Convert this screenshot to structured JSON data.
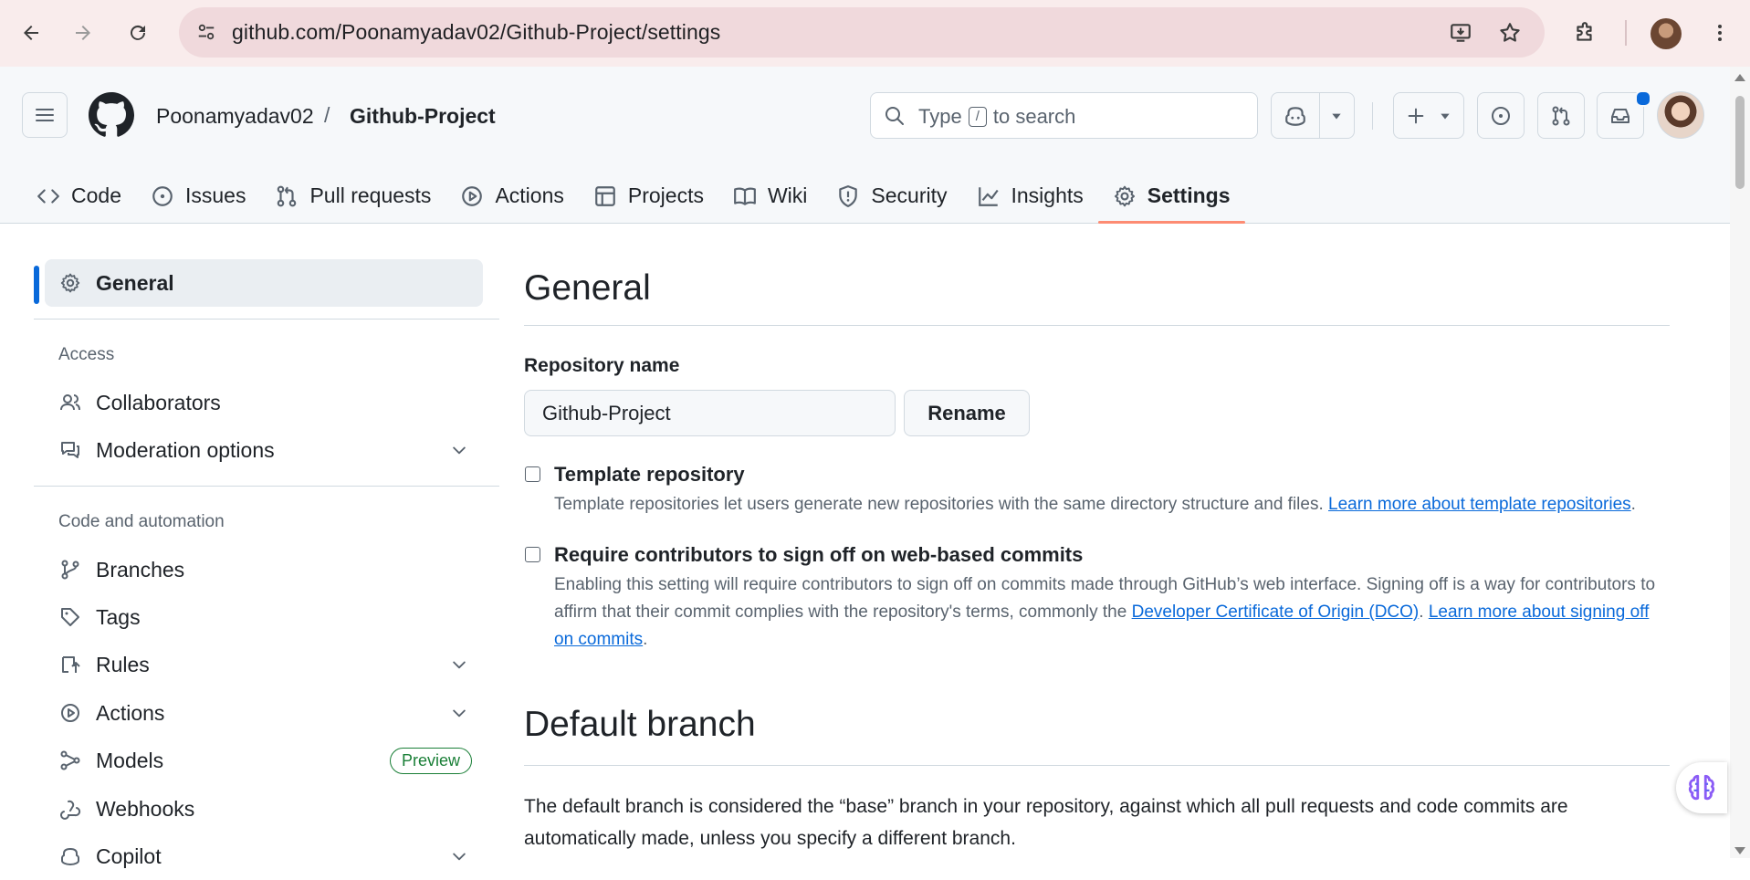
{
  "browser": {
    "url_host": "github.com",
    "url_path": "/Poonamyadav02/Github-Project/settings"
  },
  "header": {
    "owner": "Poonamyadav02",
    "separator": "/",
    "repo": "Github-Project",
    "search_type": "Type",
    "search_kbd": "/",
    "search_suffix": "to search"
  },
  "tabs": [
    {
      "label": "Code",
      "icon": "code-icon"
    },
    {
      "label": "Issues",
      "icon": "issue-icon"
    },
    {
      "label": "Pull requests",
      "icon": "pull-request-icon"
    },
    {
      "label": "Actions",
      "icon": "play-icon"
    },
    {
      "label": "Projects",
      "icon": "table-icon"
    },
    {
      "label": "Wiki",
      "icon": "book-icon"
    },
    {
      "label": "Security",
      "icon": "shield-icon"
    },
    {
      "label": "Insights",
      "icon": "graph-icon"
    },
    {
      "label": "Settings",
      "icon": "gear-icon",
      "selected": true
    }
  ],
  "sidebar": {
    "general": "General",
    "access_heading": "Access",
    "collaborators": "Collaborators",
    "moderation": "Moderation options",
    "code_heading": "Code and automation",
    "branches": "Branches",
    "tags": "Tags",
    "rules": "Rules",
    "actions": "Actions",
    "models": "Models",
    "preview_badge": "Preview",
    "webhooks": "Webhooks",
    "copilot": "Copilot"
  },
  "main": {
    "title": "General",
    "repo_name_label": "Repository name",
    "repo_name_value": "Github-Project",
    "rename_button": "Rename",
    "template": {
      "title": "Template repository",
      "desc": "Template repositories let users generate new repositories with the same directory structure and files. ",
      "link": "Learn more about template repositories",
      "end": "."
    },
    "signoff": {
      "title": "Require contributors to sign off on web-based commits",
      "desc1": "Enabling this setting will require contributors to sign off on commits made through GitHub’s web interface. Signing off is a way for contributors to affirm that their commit complies with the repository's terms, commonly the ",
      "link1": "Developer Certificate of Origin (DCO)",
      "mid": ". ",
      "link2": "Learn more about signing off on commits",
      "end": "."
    },
    "default_branch_title": "Default branch",
    "default_branch_desc": "The default branch is considered the “base” branch in your repository, against which all pull requests and code commits are automatically made, unless you specify a different branch."
  },
  "colors": {
    "accent": "#0969da",
    "tab_underline": "#fd8c73",
    "preview_green": "#1a7f37"
  }
}
